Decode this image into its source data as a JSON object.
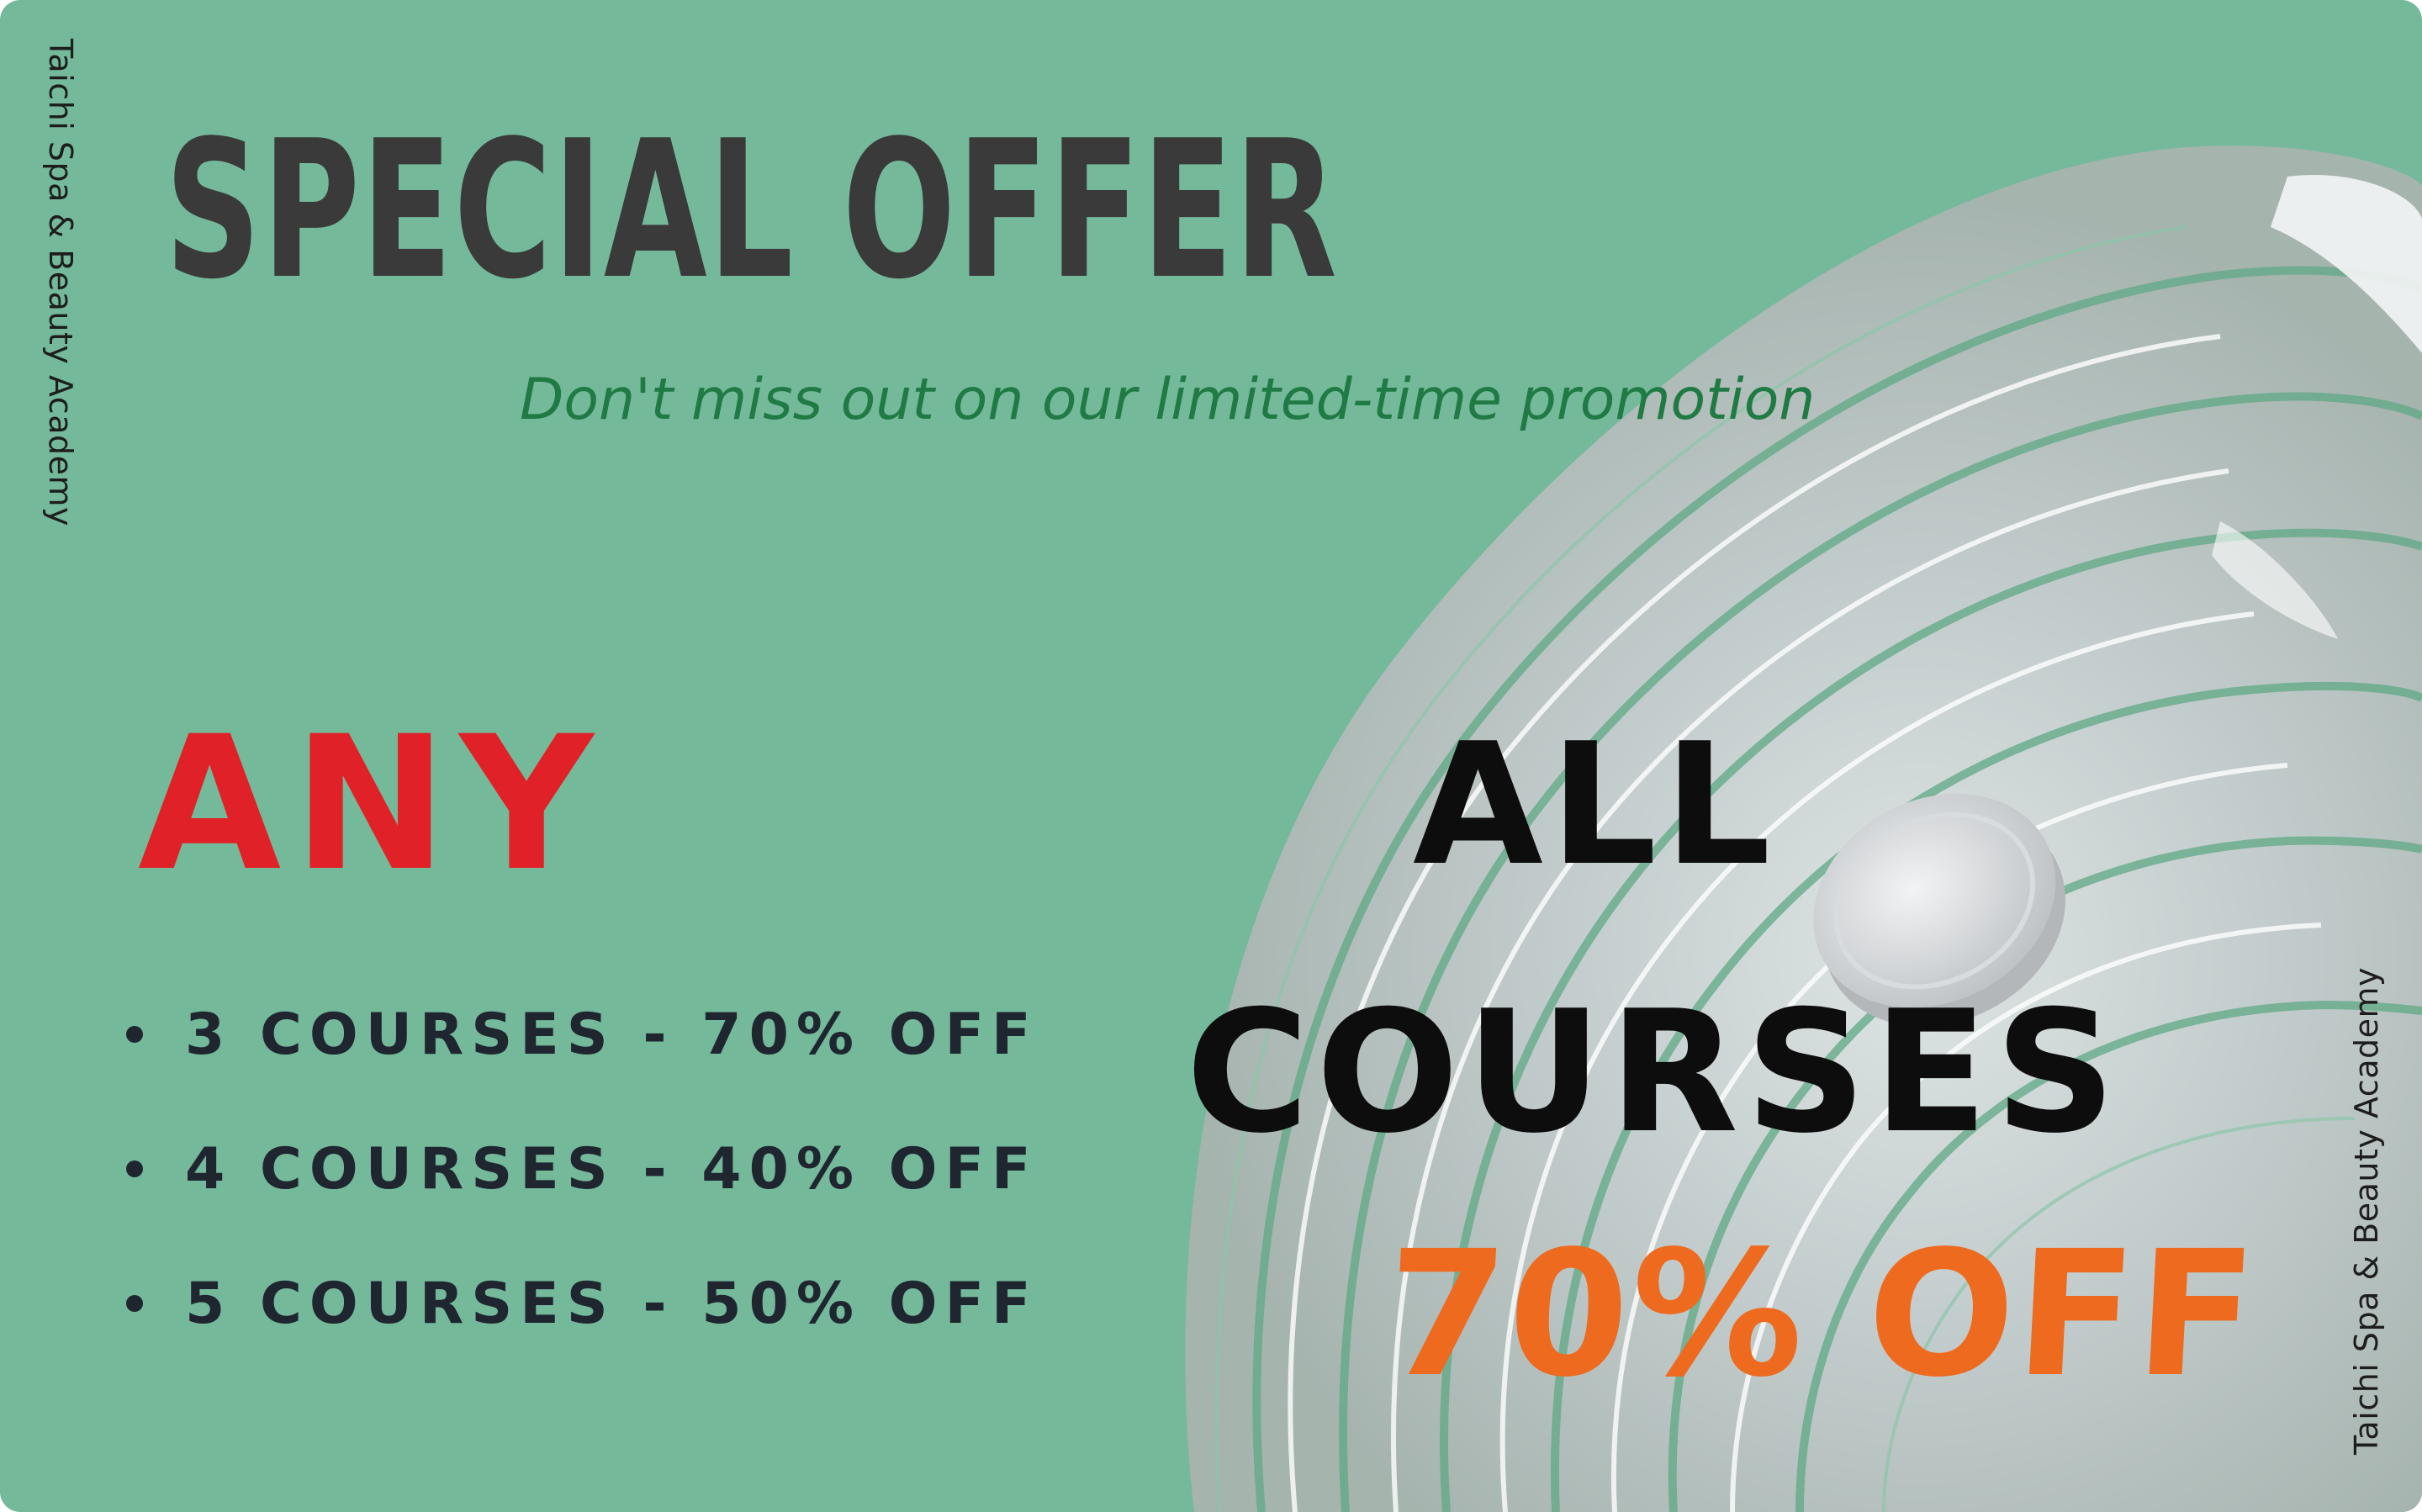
{
  "brand": {
    "name_left": "Taichi Spa & Beauty Academy",
    "name_right": "Taichi Spa & Beauty Academy"
  },
  "headline": {
    "title": "SPECIAL OFFER",
    "subtitle": "Don't miss out on our limited-time promotion"
  },
  "any_offer": {
    "label": "ANY",
    "items": [
      {
        "text": "3 COURSES - 70% OFF"
      },
      {
        "text": "4 COURSES - 40% OFF"
      },
      {
        "text": "5 COURSES - 50% OFF"
      }
    ]
  },
  "all_offer": {
    "line1": "ALL",
    "line2": "COURSES",
    "discount": "70% OFF"
  },
  "colors": {
    "background": "#75b99b",
    "title": "#3a3a3a",
    "subtitle": "#1f7a43",
    "any_label": "#e02127",
    "discount": "#ee6a1f"
  },
  "decoration": {
    "image": "glass-swirl-with-jar-lid"
  }
}
